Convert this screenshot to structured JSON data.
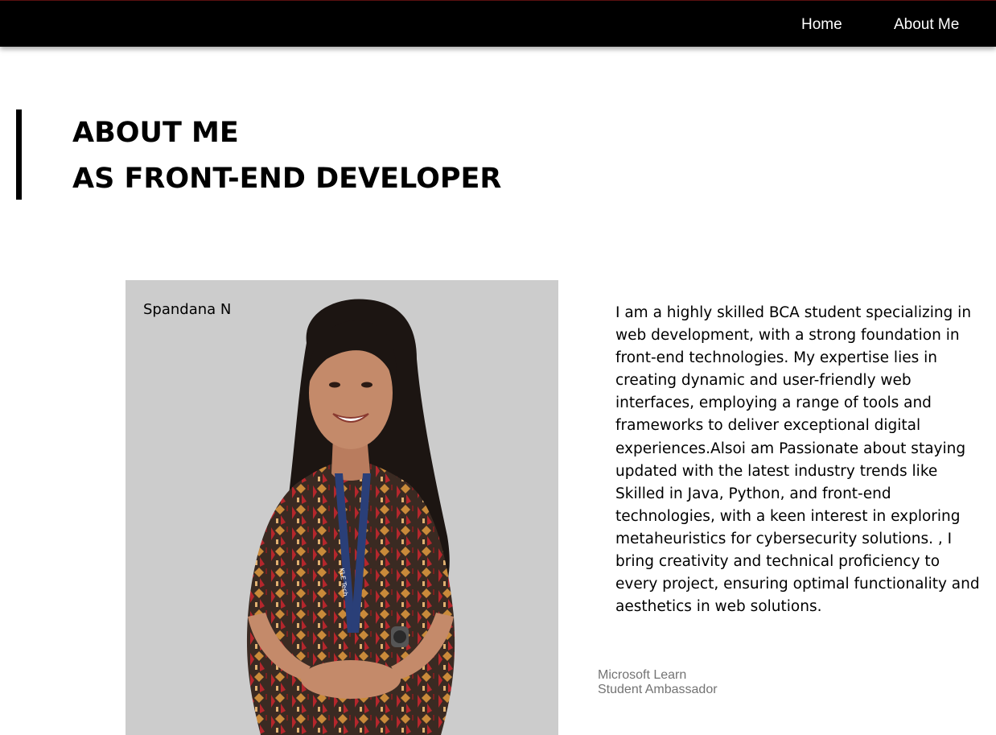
{
  "nav": {
    "home_label": "Home",
    "about_label": "About Me"
  },
  "heading": {
    "line1": "ABOUT ME",
    "line2": "AS FRONT-END DEVELOPER"
  },
  "profile": {
    "name": "Spandana N",
    "bio": "I am a highly skilled BCA student specializing in web development, with a strong foundation in front-end technologies. My expertise lies in creating dynamic and user-friendly web interfaces, employing a range of tools and frameworks to deliver exceptional digital experiences.Alsoi am Passionate about staying updated with the latest industry trends like Skilled in Java, Python, and front-end technologies, with a keen interest in exploring metaheuristics for cybersecurity solutions. , I bring creativity and technical proficiency to every project, ensuring optimal functionality and aesthetics in web solutions."
  },
  "badge": {
    "line1": "Microsoft Learn",
    "line2": "Student Ambassador"
  },
  "lanyard_text": "KLE Tech",
  "colors": {
    "nav_bg": "#000000",
    "nav_text": "#ffffff",
    "photo_bg": "#cccccc",
    "badge_text": "#737373"
  }
}
